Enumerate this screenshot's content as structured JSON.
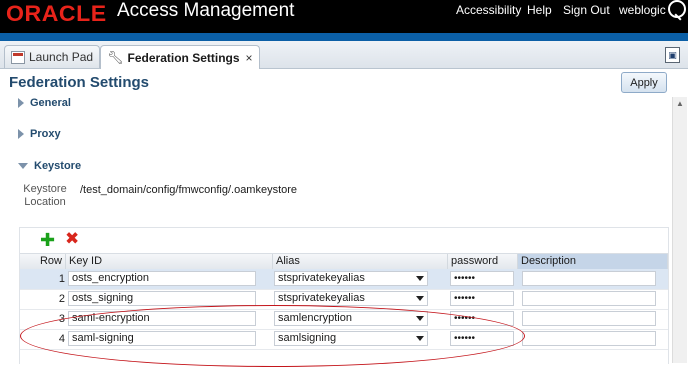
{
  "header": {
    "logo": "ORACLE",
    "product": "Access Management",
    "links": [
      "Accessibility",
      "Help",
      "Sign Out",
      "weblogic"
    ]
  },
  "tabs": [
    {
      "label": "Launch Pad"
    },
    {
      "label": "Federation Settings",
      "close": "×"
    }
  ],
  "page": {
    "title": "Federation Settings",
    "apply_label": "Apply"
  },
  "sections": {
    "general": "General",
    "proxy": "Proxy",
    "keystore": "Keystore"
  },
  "keystore": {
    "location_label_line1": "Keystore",
    "location_label_line2": "Location",
    "location_value": "/test_domain/config/fmwconfig/.oamkeystore"
  },
  "table": {
    "columns": [
      "Row",
      "Key ID",
      "Alias",
      "password",
      "Description"
    ],
    "rows": [
      {
        "row": "1",
        "key_id": "osts_encryption",
        "alias": "stsprivatekeyalias",
        "password": "••••••",
        "description": ""
      },
      {
        "row": "2",
        "key_id": "osts_signing",
        "alias": "stsprivatekeyalias",
        "password": "••••••",
        "description": ""
      },
      {
        "row": "3",
        "key_id": "saml-encryption",
        "alias": "samlencryption",
        "password": "••••••",
        "description": ""
      },
      {
        "row": "4",
        "key_id": "saml-signing",
        "alias": "samlsigning",
        "password": "••••••",
        "description": ""
      }
    ]
  },
  "colors": {
    "banner": "#000000",
    "accent_bar": "#0b5fa6",
    "title": "#234b6e",
    "highlight_oval": "#c4161c",
    "selected_row": "#dbe6f3"
  },
  "icons": {
    "add": "plus-icon",
    "delete": "delete-icon"
  }
}
